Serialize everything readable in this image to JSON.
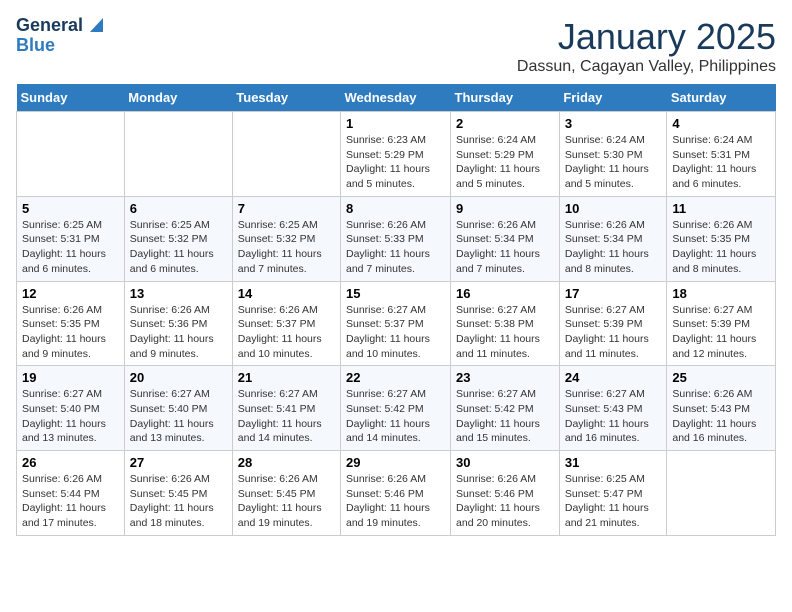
{
  "header": {
    "logo_line1": "General",
    "logo_line2": "Blue",
    "month": "January 2025",
    "location": "Dassun, Cagayan Valley, Philippines"
  },
  "weekdays": [
    "Sunday",
    "Monday",
    "Tuesday",
    "Wednesday",
    "Thursday",
    "Friday",
    "Saturday"
  ],
  "weeks": [
    [
      {
        "day": "",
        "info": ""
      },
      {
        "day": "",
        "info": ""
      },
      {
        "day": "",
        "info": ""
      },
      {
        "day": "1",
        "info": "Sunrise: 6:23 AM\nSunset: 5:29 PM\nDaylight: 11 hours and 5 minutes."
      },
      {
        "day": "2",
        "info": "Sunrise: 6:24 AM\nSunset: 5:29 PM\nDaylight: 11 hours and 5 minutes."
      },
      {
        "day": "3",
        "info": "Sunrise: 6:24 AM\nSunset: 5:30 PM\nDaylight: 11 hours and 5 minutes."
      },
      {
        "day": "4",
        "info": "Sunrise: 6:24 AM\nSunset: 5:31 PM\nDaylight: 11 hours and 6 minutes."
      }
    ],
    [
      {
        "day": "5",
        "info": "Sunrise: 6:25 AM\nSunset: 5:31 PM\nDaylight: 11 hours and 6 minutes."
      },
      {
        "day": "6",
        "info": "Sunrise: 6:25 AM\nSunset: 5:32 PM\nDaylight: 11 hours and 6 minutes."
      },
      {
        "day": "7",
        "info": "Sunrise: 6:25 AM\nSunset: 5:32 PM\nDaylight: 11 hours and 7 minutes."
      },
      {
        "day": "8",
        "info": "Sunrise: 6:26 AM\nSunset: 5:33 PM\nDaylight: 11 hours and 7 minutes."
      },
      {
        "day": "9",
        "info": "Sunrise: 6:26 AM\nSunset: 5:34 PM\nDaylight: 11 hours and 7 minutes."
      },
      {
        "day": "10",
        "info": "Sunrise: 6:26 AM\nSunset: 5:34 PM\nDaylight: 11 hours and 8 minutes."
      },
      {
        "day": "11",
        "info": "Sunrise: 6:26 AM\nSunset: 5:35 PM\nDaylight: 11 hours and 8 minutes."
      }
    ],
    [
      {
        "day": "12",
        "info": "Sunrise: 6:26 AM\nSunset: 5:35 PM\nDaylight: 11 hours and 9 minutes."
      },
      {
        "day": "13",
        "info": "Sunrise: 6:26 AM\nSunset: 5:36 PM\nDaylight: 11 hours and 9 minutes."
      },
      {
        "day": "14",
        "info": "Sunrise: 6:26 AM\nSunset: 5:37 PM\nDaylight: 11 hours and 10 minutes."
      },
      {
        "day": "15",
        "info": "Sunrise: 6:27 AM\nSunset: 5:37 PM\nDaylight: 11 hours and 10 minutes."
      },
      {
        "day": "16",
        "info": "Sunrise: 6:27 AM\nSunset: 5:38 PM\nDaylight: 11 hours and 11 minutes."
      },
      {
        "day": "17",
        "info": "Sunrise: 6:27 AM\nSunset: 5:39 PM\nDaylight: 11 hours and 11 minutes."
      },
      {
        "day": "18",
        "info": "Sunrise: 6:27 AM\nSunset: 5:39 PM\nDaylight: 11 hours and 12 minutes."
      }
    ],
    [
      {
        "day": "19",
        "info": "Sunrise: 6:27 AM\nSunset: 5:40 PM\nDaylight: 11 hours and 13 minutes."
      },
      {
        "day": "20",
        "info": "Sunrise: 6:27 AM\nSunset: 5:40 PM\nDaylight: 11 hours and 13 minutes."
      },
      {
        "day": "21",
        "info": "Sunrise: 6:27 AM\nSunset: 5:41 PM\nDaylight: 11 hours and 14 minutes."
      },
      {
        "day": "22",
        "info": "Sunrise: 6:27 AM\nSunset: 5:42 PM\nDaylight: 11 hours and 14 minutes."
      },
      {
        "day": "23",
        "info": "Sunrise: 6:27 AM\nSunset: 5:42 PM\nDaylight: 11 hours and 15 minutes."
      },
      {
        "day": "24",
        "info": "Sunrise: 6:27 AM\nSunset: 5:43 PM\nDaylight: 11 hours and 16 minutes."
      },
      {
        "day": "25",
        "info": "Sunrise: 6:26 AM\nSunset: 5:43 PM\nDaylight: 11 hours and 16 minutes."
      }
    ],
    [
      {
        "day": "26",
        "info": "Sunrise: 6:26 AM\nSunset: 5:44 PM\nDaylight: 11 hours and 17 minutes."
      },
      {
        "day": "27",
        "info": "Sunrise: 6:26 AM\nSunset: 5:45 PM\nDaylight: 11 hours and 18 minutes."
      },
      {
        "day": "28",
        "info": "Sunrise: 6:26 AM\nSunset: 5:45 PM\nDaylight: 11 hours and 19 minutes."
      },
      {
        "day": "29",
        "info": "Sunrise: 6:26 AM\nSunset: 5:46 PM\nDaylight: 11 hours and 19 minutes."
      },
      {
        "day": "30",
        "info": "Sunrise: 6:26 AM\nSunset: 5:46 PM\nDaylight: 11 hours and 20 minutes."
      },
      {
        "day": "31",
        "info": "Sunrise: 6:25 AM\nSunset: 5:47 PM\nDaylight: 11 hours and 21 minutes."
      },
      {
        "day": "",
        "info": ""
      }
    ]
  ]
}
